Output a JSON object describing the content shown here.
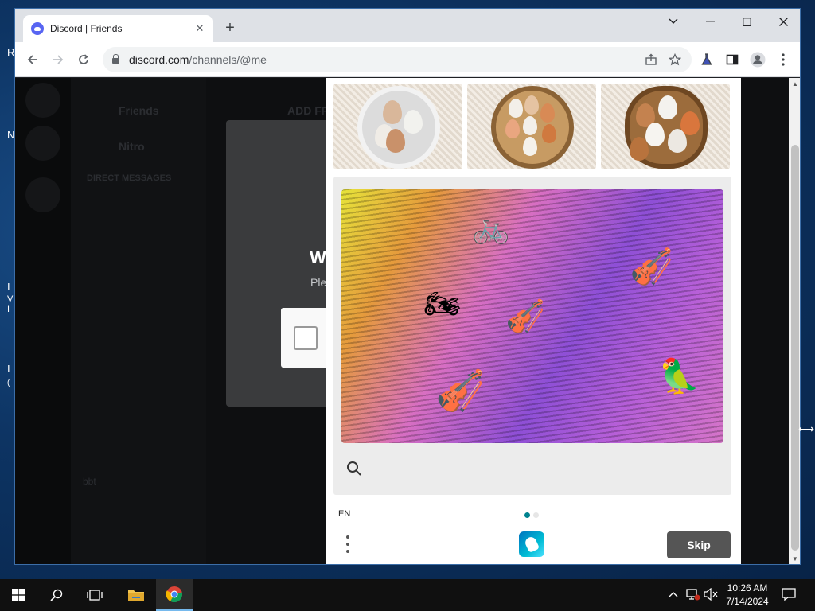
{
  "browser": {
    "tab_title": "Discord | Friends",
    "tab_close": "✕",
    "new_tab": "+",
    "url_host": "discord.com",
    "url_path": "/channels/@me"
  },
  "desktop": {
    "letters": [
      "R",
      "N",
      "I",
      "V",
      "I",
      "I",
      "("
    ]
  },
  "discord": {
    "friends": "Friends",
    "add_friend": "ADD FRIEND",
    "nitro": "Nitro",
    "direct_messages": "DIRECT MESSAGES",
    "modal_title": "W",
    "modal_sub": "Ple",
    "username": "bbt"
  },
  "challenge": {
    "language": "EN",
    "skip_label": "Skip",
    "objects": [
      "bicycle",
      "motorcycle",
      "violin",
      "violin",
      "violin",
      "parrot"
    ]
  },
  "taskbar": {
    "time": "10:26 AM",
    "date": "7/14/2024"
  },
  "colors": {
    "accent_discord": "#5865f2",
    "hcaptcha_teal": "#00838f",
    "skip_button": "#555555"
  }
}
